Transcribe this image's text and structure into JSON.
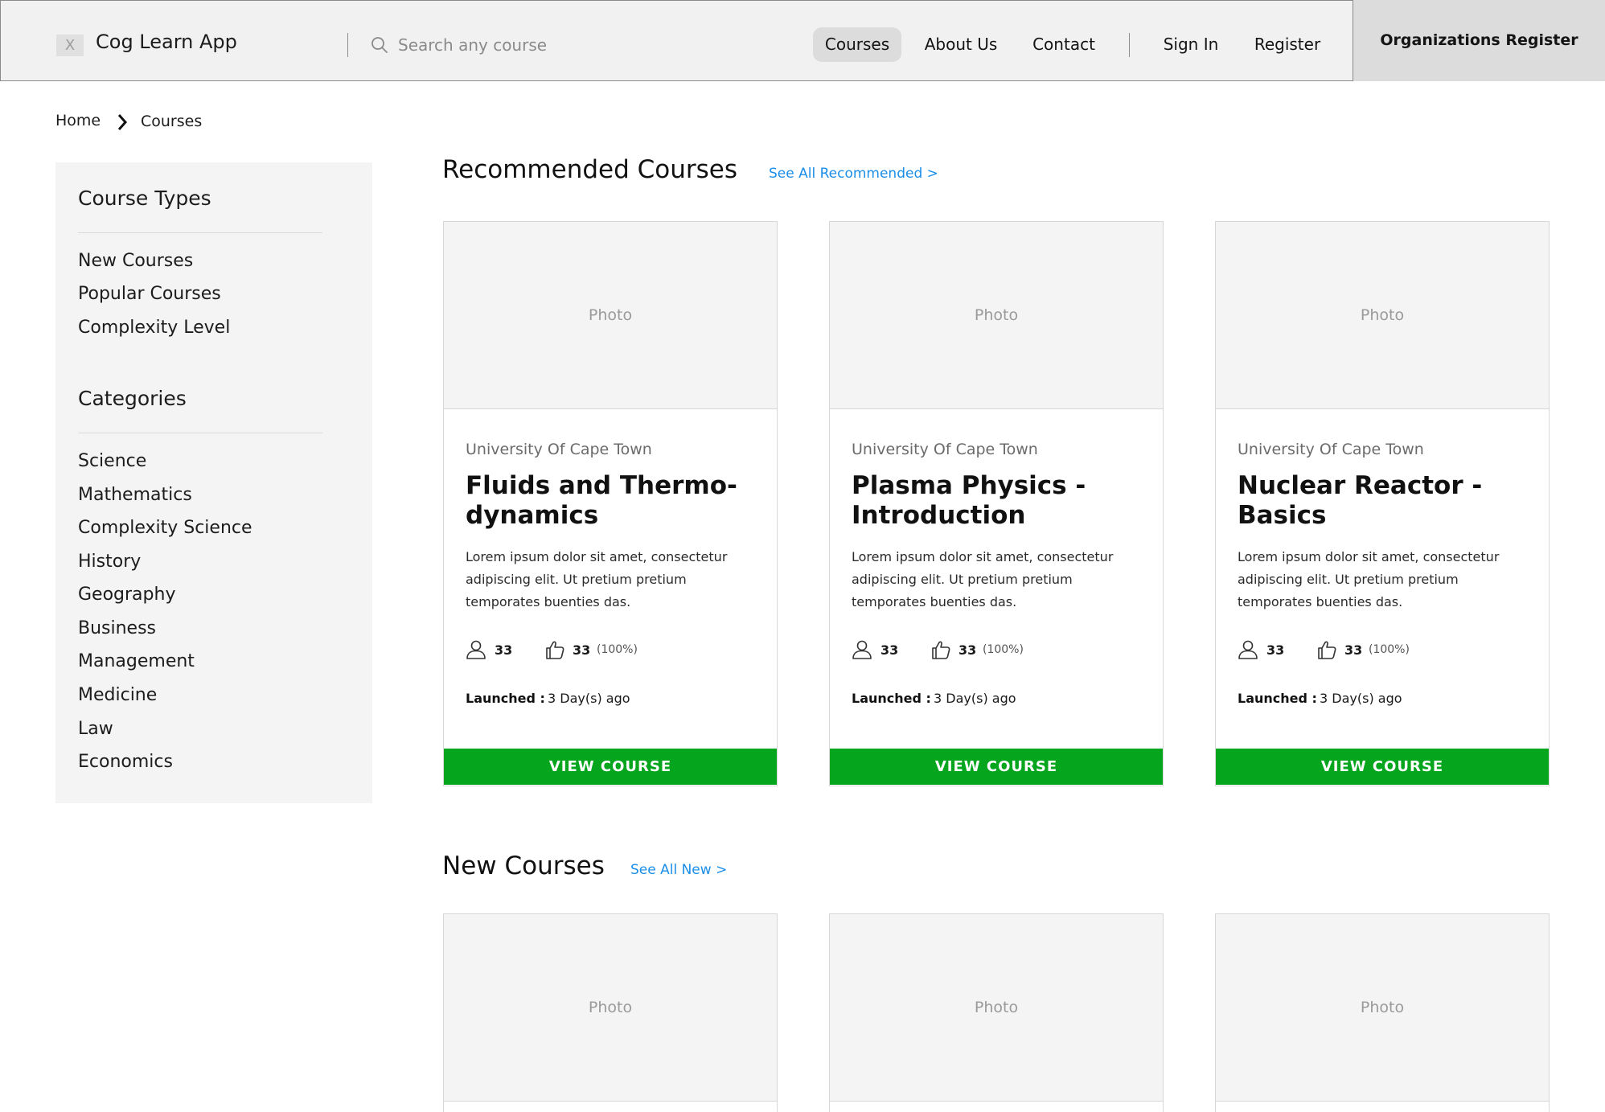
{
  "header": {
    "logo_glyph": "X",
    "app_title": "Cog Learn App",
    "search_placeholder": "Search any course",
    "nav": [
      "Courses",
      "About Us",
      "Contact"
    ],
    "auth": [
      "Sign In",
      "Register"
    ],
    "org_register": "Organizations Register"
  },
  "breadcrumb": {
    "home": "Home",
    "current": "Courses"
  },
  "sidebar": {
    "course_types_title": "Course Types",
    "course_types": [
      "New Courses",
      "Popular Courses",
      "Complexity Level"
    ],
    "categories_title": "Categories",
    "categories": [
      "Science",
      "Mathematics",
      "Complexity Science",
      "History",
      "Geography",
      "Business",
      "Management",
      "Medicine",
      "Law",
      "Economics"
    ]
  },
  "recommended": {
    "title": "Recommended Courses",
    "see_all": "See All Recommended >",
    "cards": [
      {
        "photo": "Photo",
        "org": "University Of Cape Town",
        "title": "Fluids and Thermo-dynamics",
        "desc": "Lorem ipsum dolor sit amet, consectetur adipiscing elit. Ut pretium pretium temporates buenties das.",
        "learners": "33",
        "likes": "33",
        "like_pct": "(100%)",
        "launched_label": "Launched :",
        "launched_value": "3 Day(s) ago",
        "button": "VIEW COURSE"
      },
      {
        "photo": "Photo",
        "org": "University Of Cape Town",
        "title": "Plasma Physics - Introduction",
        "desc": "Lorem ipsum dolor sit amet, consectetur adipiscing elit. Ut pretium pretium temporates buenties das.",
        "learners": "33",
        "likes": "33",
        "like_pct": "(100%)",
        "launched_label": "Launched :",
        "launched_value": "3 Day(s) ago",
        "button": "VIEW COURSE"
      },
      {
        "photo": "Photo",
        "org": "University Of Cape Town",
        "title": "Nuclear Reactor - Basics",
        "desc": "Lorem ipsum dolor sit amet, consectetur adipiscing elit. Ut pretium pretium temporates buenties das.",
        "learners": "33",
        "likes": "33",
        "like_pct": "(100%)",
        "launched_label": "Launched :",
        "launched_value": "3 Day(s) ago",
        "button": "VIEW COURSE"
      }
    ]
  },
  "new_courses": {
    "title": "New Courses",
    "see_all": "See All New >",
    "cards": [
      {
        "photo": "Photo"
      },
      {
        "photo": "Photo"
      },
      {
        "photo": "Photo"
      }
    ]
  },
  "colors": {
    "header_bg": "#f1f1f1",
    "nav_active_bg": "#dcdcdc",
    "accent_link": "#1b8ee8",
    "button_green": "#05a51d",
    "sidebar_bg": "#f4f4f4",
    "photo_bg": "#f4f4f4"
  },
  "icons": {
    "search": "search-icon",
    "chevron": "chevron-right-icon",
    "learners": "user-icon",
    "likes": "thumbs-up-icon"
  }
}
